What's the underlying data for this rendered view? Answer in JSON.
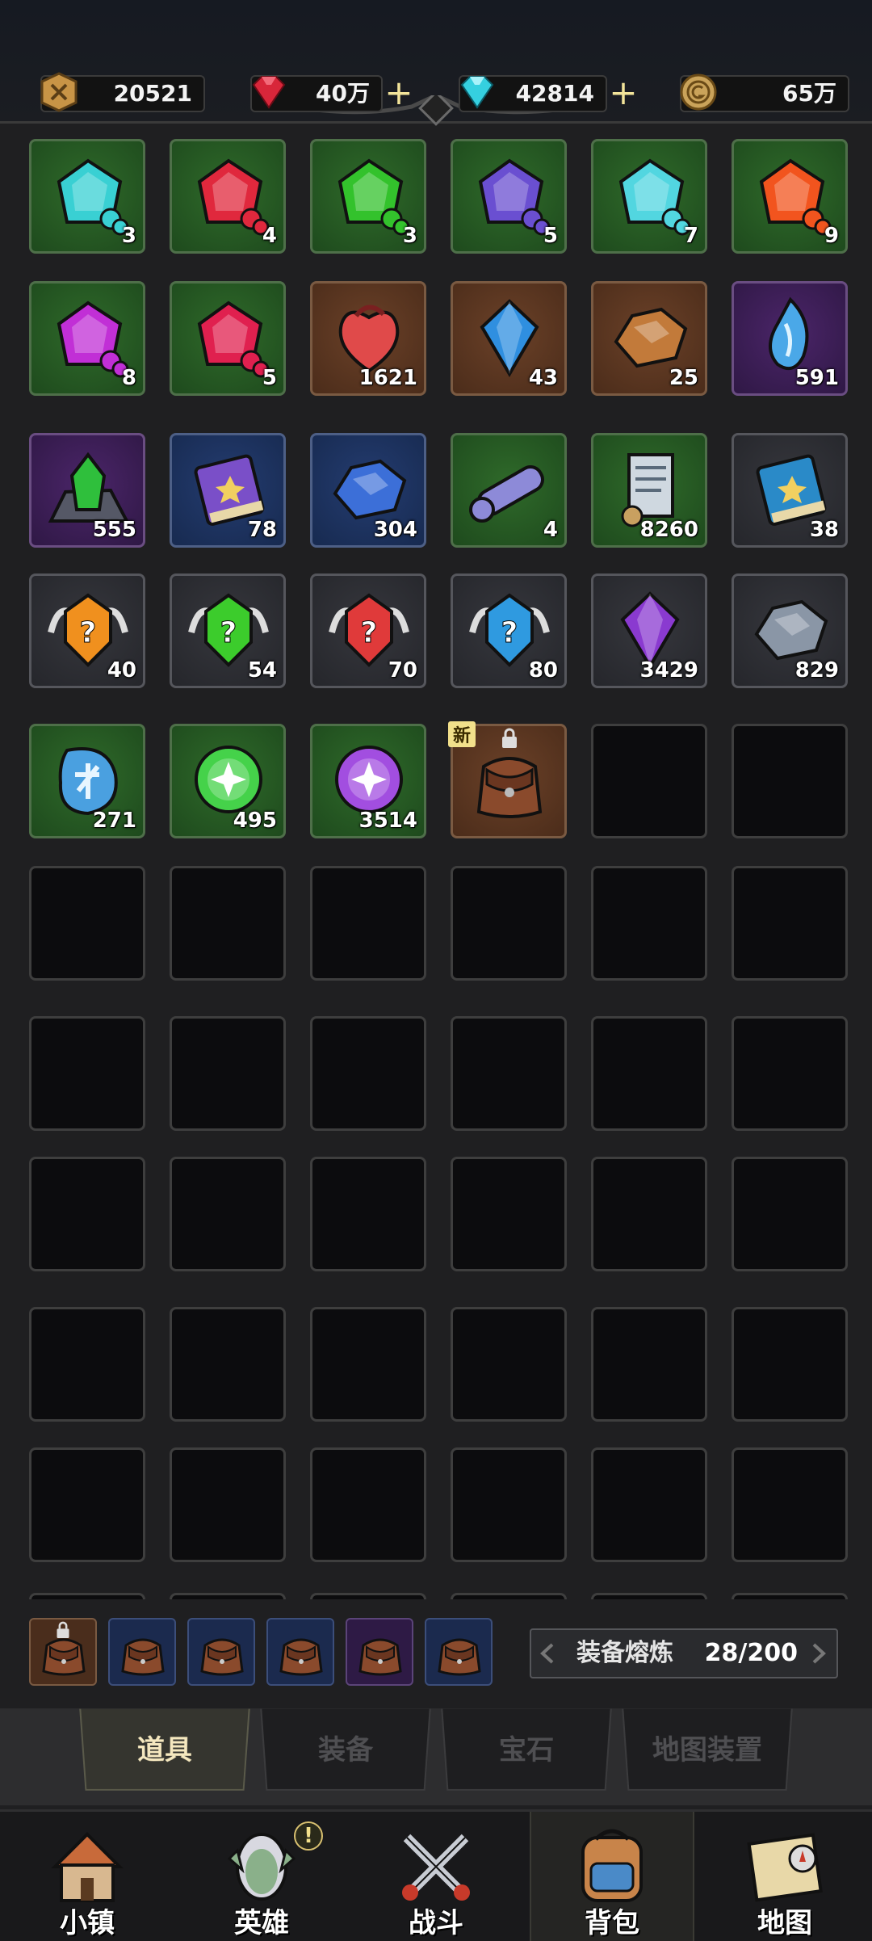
{
  "currencies": [
    {
      "name": "ticket",
      "icon": "coin-x-icon",
      "value": "20521"
    },
    {
      "name": "ruby",
      "icon": "ruby-icon",
      "value": "40万",
      "plus": "+"
    },
    {
      "name": "diamond",
      "icon": "diamond-icon",
      "value": "42814",
      "plus": "+"
    },
    {
      "name": "gold",
      "icon": "gold-coin-icon",
      "value": "65万"
    }
  ],
  "items": [
    {
      "icon": "cyan-gem-shard-icon",
      "rarity": "green",
      "count": "3",
      "color": "#39d0d3"
    },
    {
      "icon": "red-gem-shard-icon",
      "rarity": "green",
      "count": "4",
      "color": "#e0283d"
    },
    {
      "icon": "green-gem-shard-icon",
      "rarity": "green",
      "count": "3",
      "color": "#33c22c"
    },
    {
      "icon": "purple-gem-shard-icon",
      "rarity": "green",
      "count": "5",
      "color": "#6a4fd1"
    },
    {
      "icon": "cyan-gem-shard-icon",
      "rarity": "green",
      "count": "7",
      "color": "#52d6e0"
    },
    {
      "icon": "orange-gem-shard-icon",
      "rarity": "green",
      "count": "9",
      "color": "#f2541e"
    },
    {
      "icon": "magenta-gem-shard-icon",
      "rarity": "green",
      "count": "8",
      "color": "#c12fd6"
    },
    {
      "icon": "crimson-gem-shard-icon",
      "rarity": "green",
      "count": "5",
      "color": "#e0204f"
    },
    {
      "icon": "red-heart-ore-icon",
      "rarity": "orange",
      "count": "1621",
      "color": "#e04a4a"
    },
    {
      "icon": "blue-crystal-icon",
      "rarity": "orange",
      "count": "43",
      "color": "#2f8fe0"
    },
    {
      "icon": "copper-ore-icon",
      "rarity": "orange",
      "count": "25",
      "color": "#c27a3a"
    },
    {
      "icon": "blue-soul-crystal-icon",
      "rarity": "purple",
      "count": "591",
      "color": "#4aa8e8"
    },
    {
      "icon": "green-crystal-rock-icon",
      "rarity": "purple",
      "count": "555",
      "color": "#2fbf3c"
    },
    {
      "icon": "purple-skill-book-icon",
      "rarity": "blue",
      "count": "78",
      "color": "#7a4fc8"
    },
    {
      "icon": "blue-ore-icon",
      "rarity": "blue",
      "count": "304",
      "color": "#3c6fd8"
    },
    {
      "icon": "scroll-icon",
      "rarity": "green",
      "count": "4",
      "color": "#8d8ad8"
    },
    {
      "icon": "parchment-map-icon",
      "rarity": "green",
      "count": "8260",
      "color": "#cfd8e0"
    },
    {
      "icon": "blue-spell-book-icon",
      "rarity": "gray",
      "count": "38",
      "color": "#2a8ac8"
    },
    {
      "icon": "orange-mystery-gem-icon",
      "rarity": "gray",
      "count": "40",
      "color": "#f0901e"
    },
    {
      "icon": "green-mystery-gem-icon",
      "rarity": "gray",
      "count": "54",
      "color": "#3ccc2c"
    },
    {
      "icon": "red-mystery-gem-icon",
      "rarity": "gray",
      "count": "70",
      "color": "#e03a3a"
    },
    {
      "icon": "blue-mystery-gem-icon",
      "rarity": "gray",
      "count": "80",
      "color": "#2f9ae0"
    },
    {
      "icon": "purple-crystal-icon",
      "rarity": "gray",
      "count": "3429",
      "color": "#8a3ad0"
    },
    {
      "icon": "gray-ore-icon",
      "rarity": "gray",
      "count": "829",
      "color": "#8a96a6"
    },
    {
      "icon": "blue-rune-stone-icon",
      "rarity": "green",
      "count": "271",
      "color": "#4aa0e0"
    },
    {
      "icon": "green-star-orb-icon",
      "rarity": "green",
      "count": "495",
      "color": "#45d24a"
    },
    {
      "icon": "purple-star-orb-icon",
      "rarity": "green",
      "count": "3514",
      "color": "#a24ee0"
    },
    {
      "icon": "leather-pouch-icon",
      "rarity": "orange",
      "count": "",
      "color": "#8a4a2c",
      "tag": "新",
      "locked": true
    }
  ],
  "bags": [
    {
      "rarity": "orange",
      "locked": true
    },
    {
      "rarity": "blue"
    },
    {
      "rarity": "blue"
    },
    {
      "rarity": "blue"
    },
    {
      "rarity": "purple"
    },
    {
      "rarity": "blue"
    }
  ],
  "refine": {
    "label": "装备熔炼",
    "count": "28/200"
  },
  "tabs": [
    {
      "label": "道具",
      "active": true
    },
    {
      "label": "装备"
    },
    {
      "label": "宝石"
    },
    {
      "label": "地图装置"
    }
  ],
  "nav": [
    {
      "label": "小镇",
      "icon": "town-icon"
    },
    {
      "label": "英雄",
      "icon": "hero-icon",
      "alert": "!"
    },
    {
      "label": "战斗",
      "icon": "crossed-swords-icon"
    },
    {
      "label": "背包",
      "icon": "backpack-icon",
      "active": true
    },
    {
      "label": "地图",
      "icon": "map-scroll-icon"
    }
  ]
}
